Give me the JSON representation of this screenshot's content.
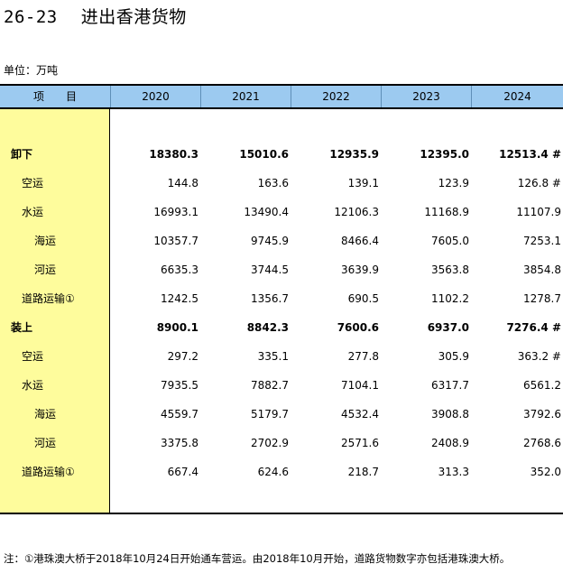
{
  "title_number": "26-23",
  "title_text": "进出香港货物",
  "unit": "单位：万吨",
  "header": {
    "item": "项　　目",
    "years": [
      "2020",
      "2021",
      "2022",
      "2023",
      "2024"
    ]
  },
  "rows": [
    {
      "label": "卸下",
      "indent": 0,
      "bold": true,
      "values": [
        "18380.3",
        "15010.6",
        "12935.9",
        "12395.0",
        "12513.4 #"
      ]
    },
    {
      "label": "空运",
      "indent": 1,
      "bold": false,
      "values": [
        "144.8",
        "163.6",
        "139.1",
        "123.9",
        "126.8 #"
      ]
    },
    {
      "label": "水运",
      "indent": 1,
      "bold": false,
      "values": [
        "16993.1",
        "13490.4",
        "12106.3",
        "11168.9",
        "11107.9"
      ]
    },
    {
      "label": "海运",
      "indent": 2,
      "bold": false,
      "values": [
        "10357.7",
        "9745.9",
        "8466.4",
        "7605.0",
        "7253.1"
      ]
    },
    {
      "label": "河运",
      "indent": 2,
      "bold": false,
      "values": [
        "6635.3",
        "3744.5",
        "3639.9",
        "3563.8",
        "3854.8"
      ]
    },
    {
      "label": "道路运输①",
      "indent": 1,
      "bold": false,
      "values": [
        "1242.5",
        "1356.7",
        "690.5",
        "1102.2",
        "1278.7"
      ]
    },
    {
      "label": "装上",
      "indent": 0,
      "bold": true,
      "values": [
        "8900.1",
        "8842.3",
        "7600.6",
        "6937.0",
        "7276.4 #"
      ]
    },
    {
      "label": "空运",
      "indent": 1,
      "bold": false,
      "values": [
        "297.2",
        "335.1",
        "277.8",
        "305.9",
        "363.2 #"
      ]
    },
    {
      "label": "水运",
      "indent": 1,
      "bold": false,
      "values": [
        "7935.5",
        "7882.7",
        "7104.1",
        "6317.7",
        "6561.2"
      ]
    },
    {
      "label": "海运",
      "indent": 2,
      "bold": false,
      "values": [
        "4559.7",
        "5179.7",
        "4532.4",
        "3908.8",
        "3792.6"
      ]
    },
    {
      "label": "河运",
      "indent": 2,
      "bold": false,
      "values": [
        "3375.8",
        "2702.9",
        "2571.6",
        "2408.9",
        "2768.6"
      ]
    },
    {
      "label": "道路运输①",
      "indent": 1,
      "bold": false,
      "values": [
        "667.4",
        "624.6",
        "218.7",
        "313.3",
        "352.0"
      ]
    }
  ],
  "note": "注：①港珠澳大桥于2018年10月24日开始通车营运。由2018年10月开始，道路货物数字亦包括港珠澳大桥。"
}
